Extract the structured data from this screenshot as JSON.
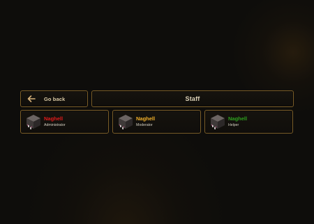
{
  "nav": {
    "back_label": "Go back",
    "back_icon": "arrow-left-icon",
    "accent_color": "#d7b27a"
  },
  "header": {
    "title": "Staff"
  },
  "staff": [
    {
      "name": "Naghell",
      "role": "Administrator",
      "name_color": "#e01b1b",
      "avatar_icon": "player-head-icon"
    },
    {
      "name": "Naghell",
      "role": "Moderator",
      "name_color": "#f2b02a",
      "avatar_icon": "player-head-icon"
    },
    {
      "name": "Naghell",
      "role": "Helper",
      "name_color": "#2ea01f",
      "avatar_icon": "player-head-icon"
    }
  ],
  "theme": {
    "background": "#0e0d0b",
    "panel_border": "#7a5d28"
  }
}
